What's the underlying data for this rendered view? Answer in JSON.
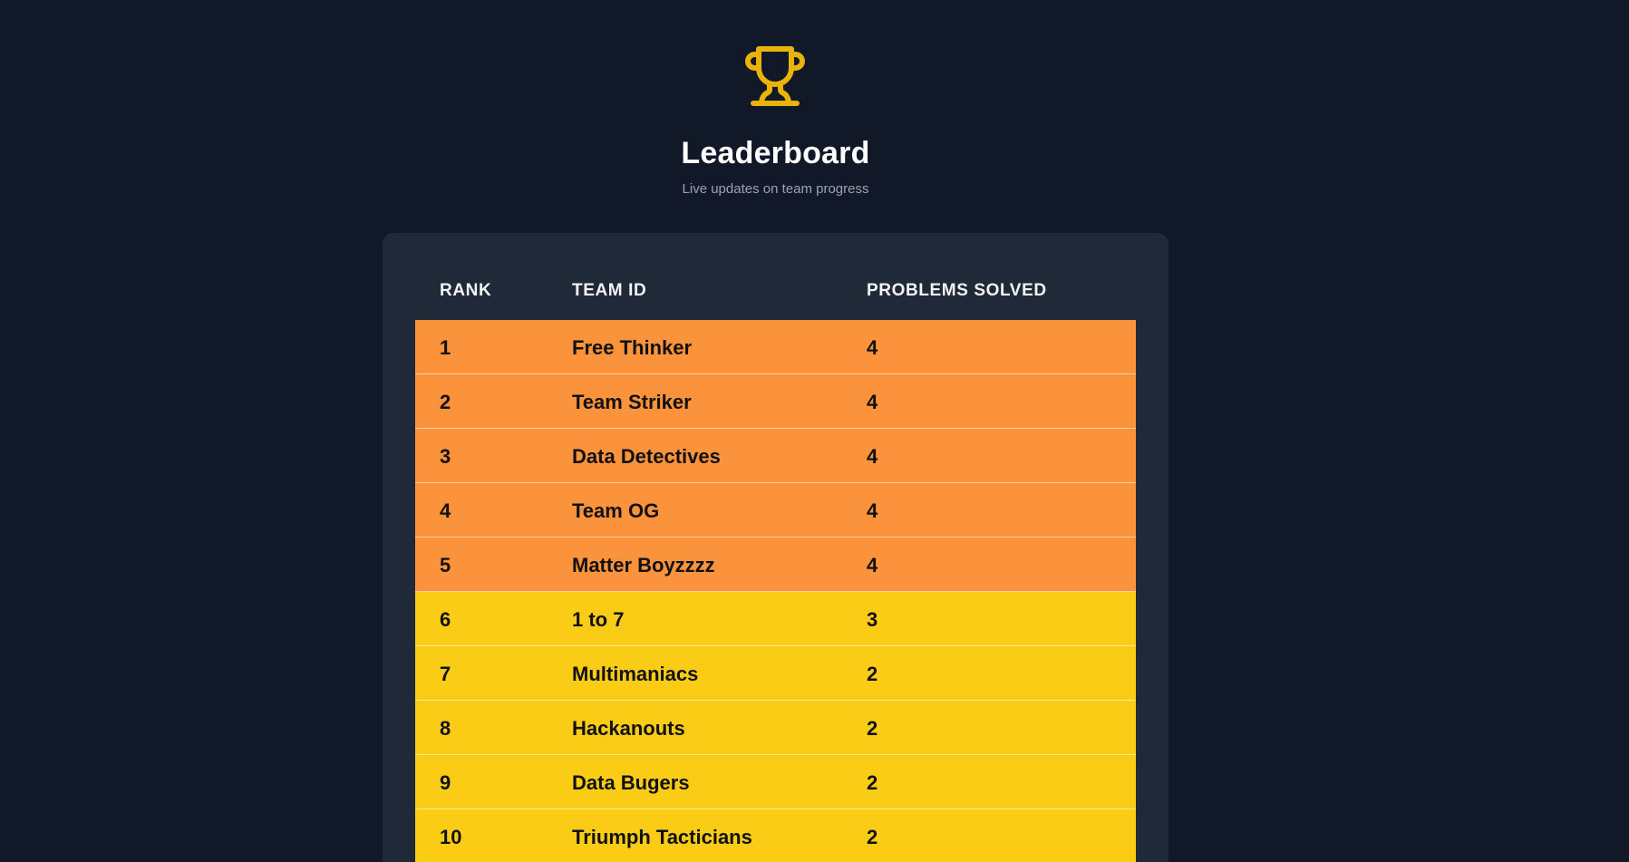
{
  "header": {
    "icon": "trophy-icon",
    "title": "Leaderboard",
    "subtitle": "Live updates on team progress"
  },
  "table": {
    "columns": [
      "RANK",
      "TEAM ID",
      "PROBLEMS SOLVED"
    ],
    "rows": [
      {
        "rank": "1",
        "team": "Free Thinker",
        "solved": "4",
        "tier": "orange"
      },
      {
        "rank": "2",
        "team": "Team Striker",
        "solved": "4",
        "tier": "orange"
      },
      {
        "rank": "3",
        "team": "Data Detectives",
        "solved": "4",
        "tier": "orange"
      },
      {
        "rank": "4",
        "team": "Team OG",
        "solved": "4",
        "tier": "orange"
      },
      {
        "rank": "5",
        "team": "Matter Boyzzzz",
        "solved": "4",
        "tier": "orange"
      },
      {
        "rank": "6",
        "team": "1 to 7",
        "solved": "3",
        "tier": "yellow"
      },
      {
        "rank": "7",
        "team": "Multimaniacs",
        "solved": "2",
        "tier": "yellow"
      },
      {
        "rank": "8",
        "team": "Hackanouts",
        "solved": "2",
        "tier": "yellow"
      },
      {
        "rank": "9",
        "team": "Data Bugers",
        "solved": "2",
        "tier": "yellow"
      },
      {
        "rank": "10",
        "team": "Triumph Tacticians",
        "solved": "2",
        "tier": "yellow"
      }
    ]
  },
  "colors": {
    "background": "#111827",
    "card": "#1f2937",
    "trophy": "#eab308",
    "top_tier": "#fb923c",
    "second_tier": "#facc15"
  }
}
